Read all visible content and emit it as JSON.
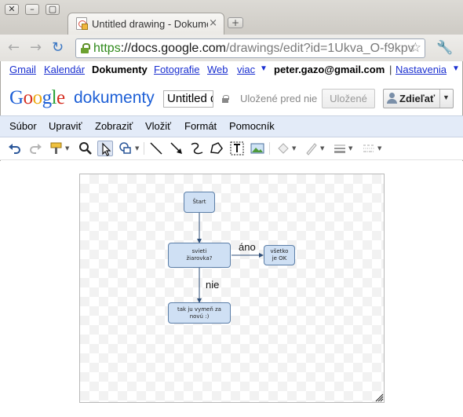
{
  "window": {
    "buttons": [
      "✕",
      "–",
      "▢"
    ]
  },
  "browser": {
    "tab_title": "Untitled drawing - Dokumenty Google",
    "tab_close": "×",
    "new_tab": "+",
    "url_scheme": "https",
    "url_host": "://docs.google.com",
    "url_path": "/drawings/edit?id=1Ukva_O-f9kpv"
  },
  "gbar": {
    "links": [
      "Gmail",
      "Kalendár",
      "Dokumenty",
      "Fotografie",
      "Web",
      "viac"
    ],
    "active": "Dokumenty",
    "more_arrow": "▼",
    "user_email": "peter.gazo@gmail.com",
    "separator": "|",
    "settings": "Nastavenia",
    "settings_arrow": "▼"
  },
  "header": {
    "logo": "Google",
    "product": "dokumenty",
    "doc_title": "Untitled drawing",
    "saved_status": "Uložené pred nie",
    "saved_button": "Uložené",
    "share_button": "Zdieľať",
    "share_arrow": "▼"
  },
  "menu": {
    "items": [
      "Súbor",
      "Upraviť",
      "Zobraziť",
      "Vložiť",
      "Formát",
      "Pomocník"
    ]
  },
  "toolbar": {
    "tools": [
      "undo-icon",
      "redo-icon",
      "paint-format-icon",
      "zoom-icon",
      "select-icon",
      "shape-icon",
      "line-icon",
      "arrow-icon",
      "curve-icon",
      "polyline-icon",
      "text-box-icon",
      "image-icon",
      "fill-color-icon",
      "line-color-icon",
      "line-weight-icon",
      "line-dash-icon"
    ],
    "active_tool": "select-icon"
  },
  "drawing": {
    "nodes": [
      {
        "id": "start",
        "text": "Štart"
      },
      {
        "id": "decision",
        "text": "svieti žiarovka?"
      },
      {
        "id": "ok",
        "text": "všetko je OK"
      },
      {
        "id": "replace",
        "text": "tak ju vymeň za novú :)"
      }
    ],
    "edge_labels": {
      "yes": "áno",
      "no": "nie"
    },
    "colors": {
      "node_fill": "#cfe0f4",
      "node_border": "#5b7ea7",
      "connector": "#2f4f79"
    }
  }
}
